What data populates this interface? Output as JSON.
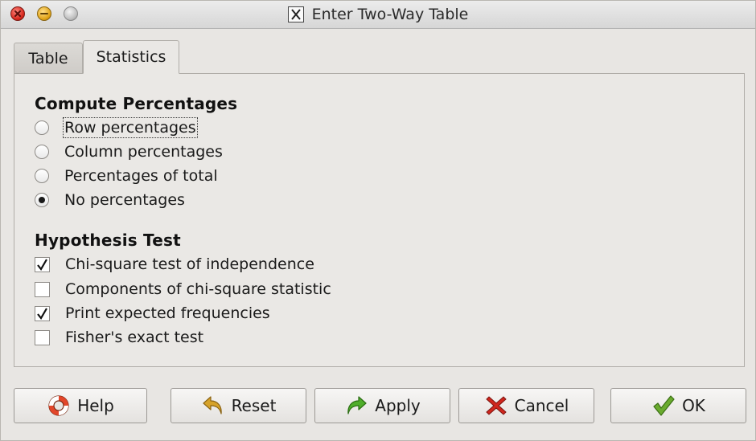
{
  "window": {
    "title": "Enter Two-Way Table",
    "title_icon": "x-window-icon"
  },
  "tabs": [
    {
      "label": "Table",
      "selected": false
    },
    {
      "label": "Statistics",
      "selected": true
    }
  ],
  "compute_percentages": {
    "title": "Compute Percentages",
    "options": [
      {
        "label": "Row percentages",
        "checked": false
      },
      {
        "label": "Column percentages",
        "checked": false
      },
      {
        "label": "Percentages of total",
        "checked": false
      },
      {
        "label": "No percentages",
        "checked": true
      }
    ]
  },
  "hypothesis_test": {
    "title": "Hypothesis Test",
    "options": [
      {
        "label": "Chi-square test of independence",
        "checked": true
      },
      {
        "label": "Components of chi-square statistic",
        "checked": false
      },
      {
        "label": "Print expected frequencies",
        "checked": true
      },
      {
        "label": "Fisher's exact test",
        "checked": false
      }
    ]
  },
  "buttons": {
    "help": "Help",
    "reset": "Reset",
    "apply": "Apply",
    "cancel": "Cancel",
    "ok": "OK"
  },
  "colors": {
    "apply_arrow": "#4fae2b",
    "reset_arrow": "#d6a22a",
    "cancel_x": "#d0261d",
    "ok_check": "#6aab2e"
  }
}
